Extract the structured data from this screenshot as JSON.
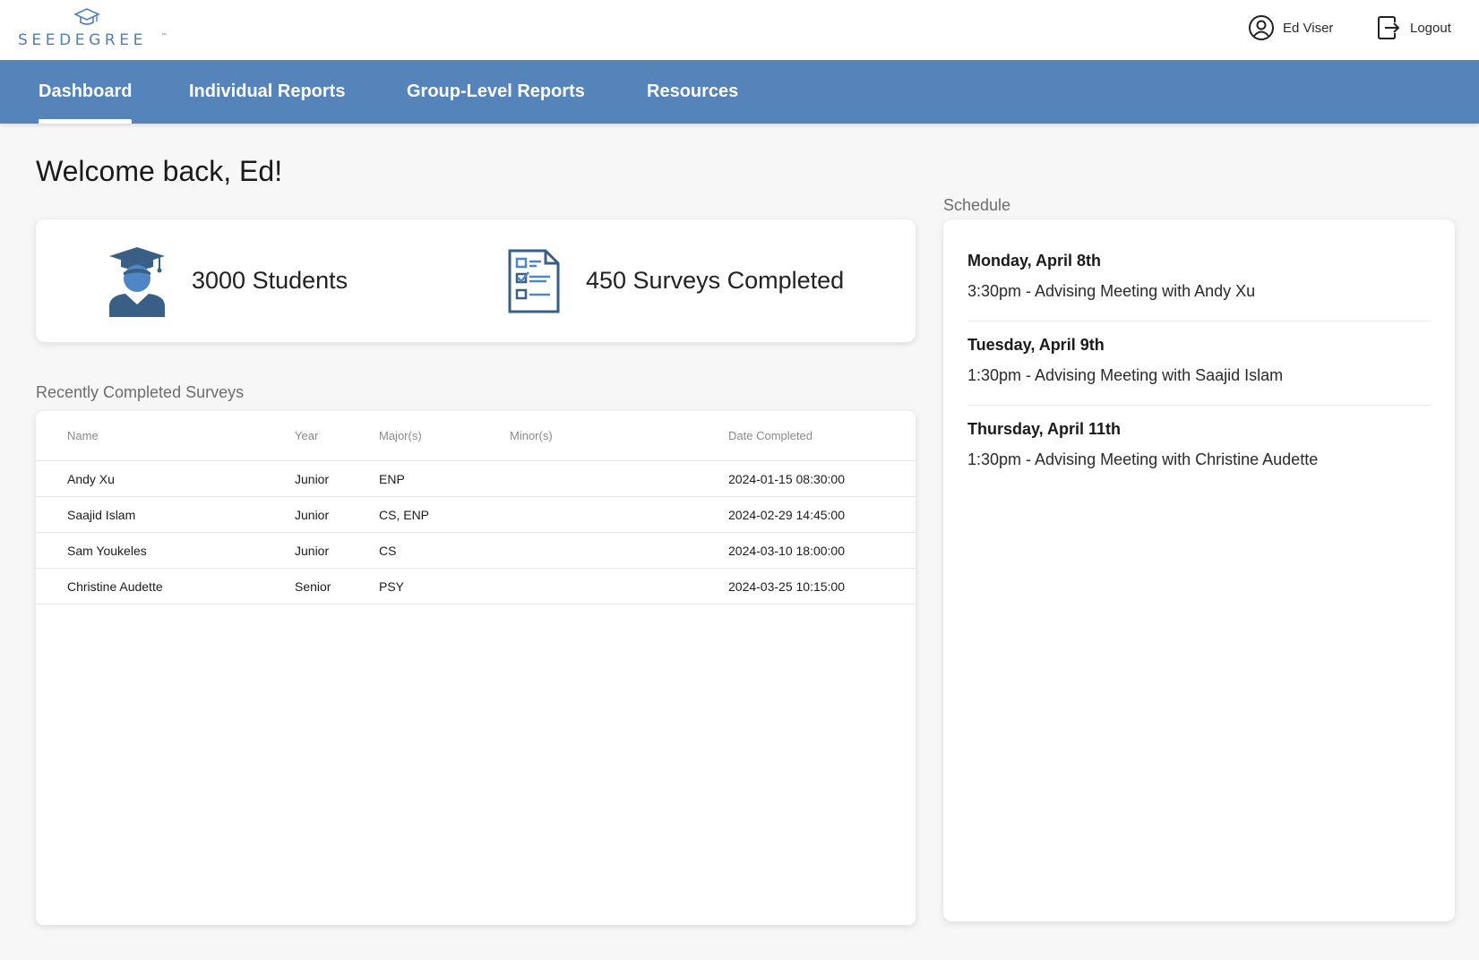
{
  "brand": {
    "name": "SEEDEGREE",
    "trademark": "™",
    "color": "#4f7fb4"
  },
  "header": {
    "user_name": "Ed Viser",
    "logout_label": "Logout"
  },
  "nav": {
    "color": "#5484b9",
    "tabs": [
      {
        "label": "Dashboard",
        "active": true
      },
      {
        "label": "Individual Reports",
        "active": false
      },
      {
        "label": "Group-Level Reports",
        "active": false
      },
      {
        "label": "Resources",
        "active": false
      }
    ]
  },
  "welcome": "Welcome back, Ed!",
  "stats": {
    "students": {
      "label": "3000 Students",
      "icon": "graduate-icon"
    },
    "surveys": {
      "label": "450 Surveys Completed",
      "icon": "survey-checklist-icon"
    }
  },
  "recent_surveys": {
    "title": "Recently Completed Surveys",
    "columns": [
      "Name",
      "Year",
      "Major(s)",
      "Minor(s)",
      "Date Completed"
    ],
    "rows": [
      {
        "name": "Andy Xu",
        "year": "Junior",
        "major": "ENP",
        "minor": "",
        "date": "2024-01-15 08:30:00"
      },
      {
        "name": "Saajid Islam",
        "year": "Junior",
        "major": "CS, ENP",
        "minor": "",
        "date": "2024-02-29 14:45:00"
      },
      {
        "name": "Sam Youkeles",
        "year": "Junior",
        "major": "CS",
        "minor": "",
        "date": "2024-03-10 18:00:00"
      },
      {
        "name": "Christine Audette",
        "year": "Senior",
        "major": "PSY",
        "minor": "",
        "date": "2024-03-25 10:15:00"
      }
    ]
  },
  "schedule": {
    "title": "Schedule",
    "events": [
      {
        "day": "Monday, April 8th",
        "desc": "3:30pm - Advising Meeting with Andy Xu"
      },
      {
        "day": "Tuesday, April 9th",
        "desc": "1:30pm - Advising Meeting with Saajid Islam"
      },
      {
        "day": "Thursday, April 11th",
        "desc": "1:30pm - Advising Meeting with Christine Audette"
      }
    ]
  }
}
